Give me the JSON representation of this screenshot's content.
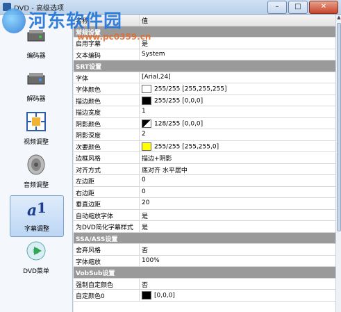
{
  "window": {
    "title": "DVD - 高级选项",
    "minimize": "–",
    "maximize": "□",
    "close": "✕"
  },
  "watermark": {
    "text": "河东软件园",
    "url": "www.pc0359.cn"
  },
  "sidebar": {
    "items": [
      {
        "label": "编码器",
        "icon": "encoder-icon"
      },
      {
        "label": "解码器",
        "icon": "decoder-icon"
      },
      {
        "label": "视频调整",
        "icon": "video-adjust-icon"
      },
      {
        "label": "音频调整",
        "icon": "audio-speaker-icon"
      },
      {
        "label": "字幕调整",
        "icon": "subtitle-icon",
        "active": true
      },
      {
        "label": "DVD菜单",
        "icon": "dvd-menu-icon"
      }
    ]
  },
  "table": {
    "header": {
      "name": "名称",
      "value": "值"
    },
    "rows": [
      {
        "type": "section",
        "name": "常规设置"
      },
      {
        "type": "item",
        "name": "启用字幕",
        "value": "是"
      },
      {
        "type": "item",
        "name": "文本编码",
        "value": "System"
      },
      {
        "type": "section",
        "name": "SRT设置"
      },
      {
        "type": "item",
        "name": "字体",
        "value": "[Arial,24]"
      },
      {
        "type": "item",
        "name": "字体颜色",
        "value": "255/255 [255,255,255]",
        "swatch": "#ffffff"
      },
      {
        "type": "item",
        "name": "描边颜色",
        "value": "255/255 [0,0,0]",
        "swatch": "#000000"
      },
      {
        "type": "item",
        "name": "描边宽度",
        "value": "1"
      },
      {
        "type": "item",
        "name": "阴影颜色",
        "value": "128/255 [0,0,0]",
        "swatch": "half"
      },
      {
        "type": "item",
        "name": "阴影深度",
        "value": "2"
      },
      {
        "type": "item",
        "name": "次要颜色",
        "value": "255/255 [255,255,0]",
        "swatch": "#ffff00"
      },
      {
        "type": "item",
        "name": "边框风格",
        "value": "描边+阴影"
      },
      {
        "type": "item",
        "name": "对齐方式",
        "value": "底对齐 水平居中"
      },
      {
        "type": "item",
        "name": "左边距",
        "value": "0"
      },
      {
        "type": "item",
        "name": "右边距",
        "value": "0"
      },
      {
        "type": "item",
        "name": "垂直边距",
        "value": "20"
      },
      {
        "type": "item",
        "name": "自动缩放字体",
        "value": "是"
      },
      {
        "type": "item",
        "name": "为DVD简化字幕样式",
        "value": "是"
      },
      {
        "type": "section",
        "name": "SSA/ASS设置"
      },
      {
        "type": "item",
        "name": "舍弃风格",
        "value": "否"
      },
      {
        "type": "item",
        "name": "字体缩放",
        "value": "100%"
      },
      {
        "type": "section",
        "name": "VobSub设置"
      },
      {
        "type": "item",
        "name": "强制自定颜色",
        "value": "否"
      },
      {
        "type": "item",
        "name": "自定颜色0",
        "value": "[0,0,0]",
        "swatch": "#000000"
      }
    ]
  },
  "colors": {
    "section_bg": "#9a9a9a",
    "active_nav": "#bcd6f4"
  }
}
